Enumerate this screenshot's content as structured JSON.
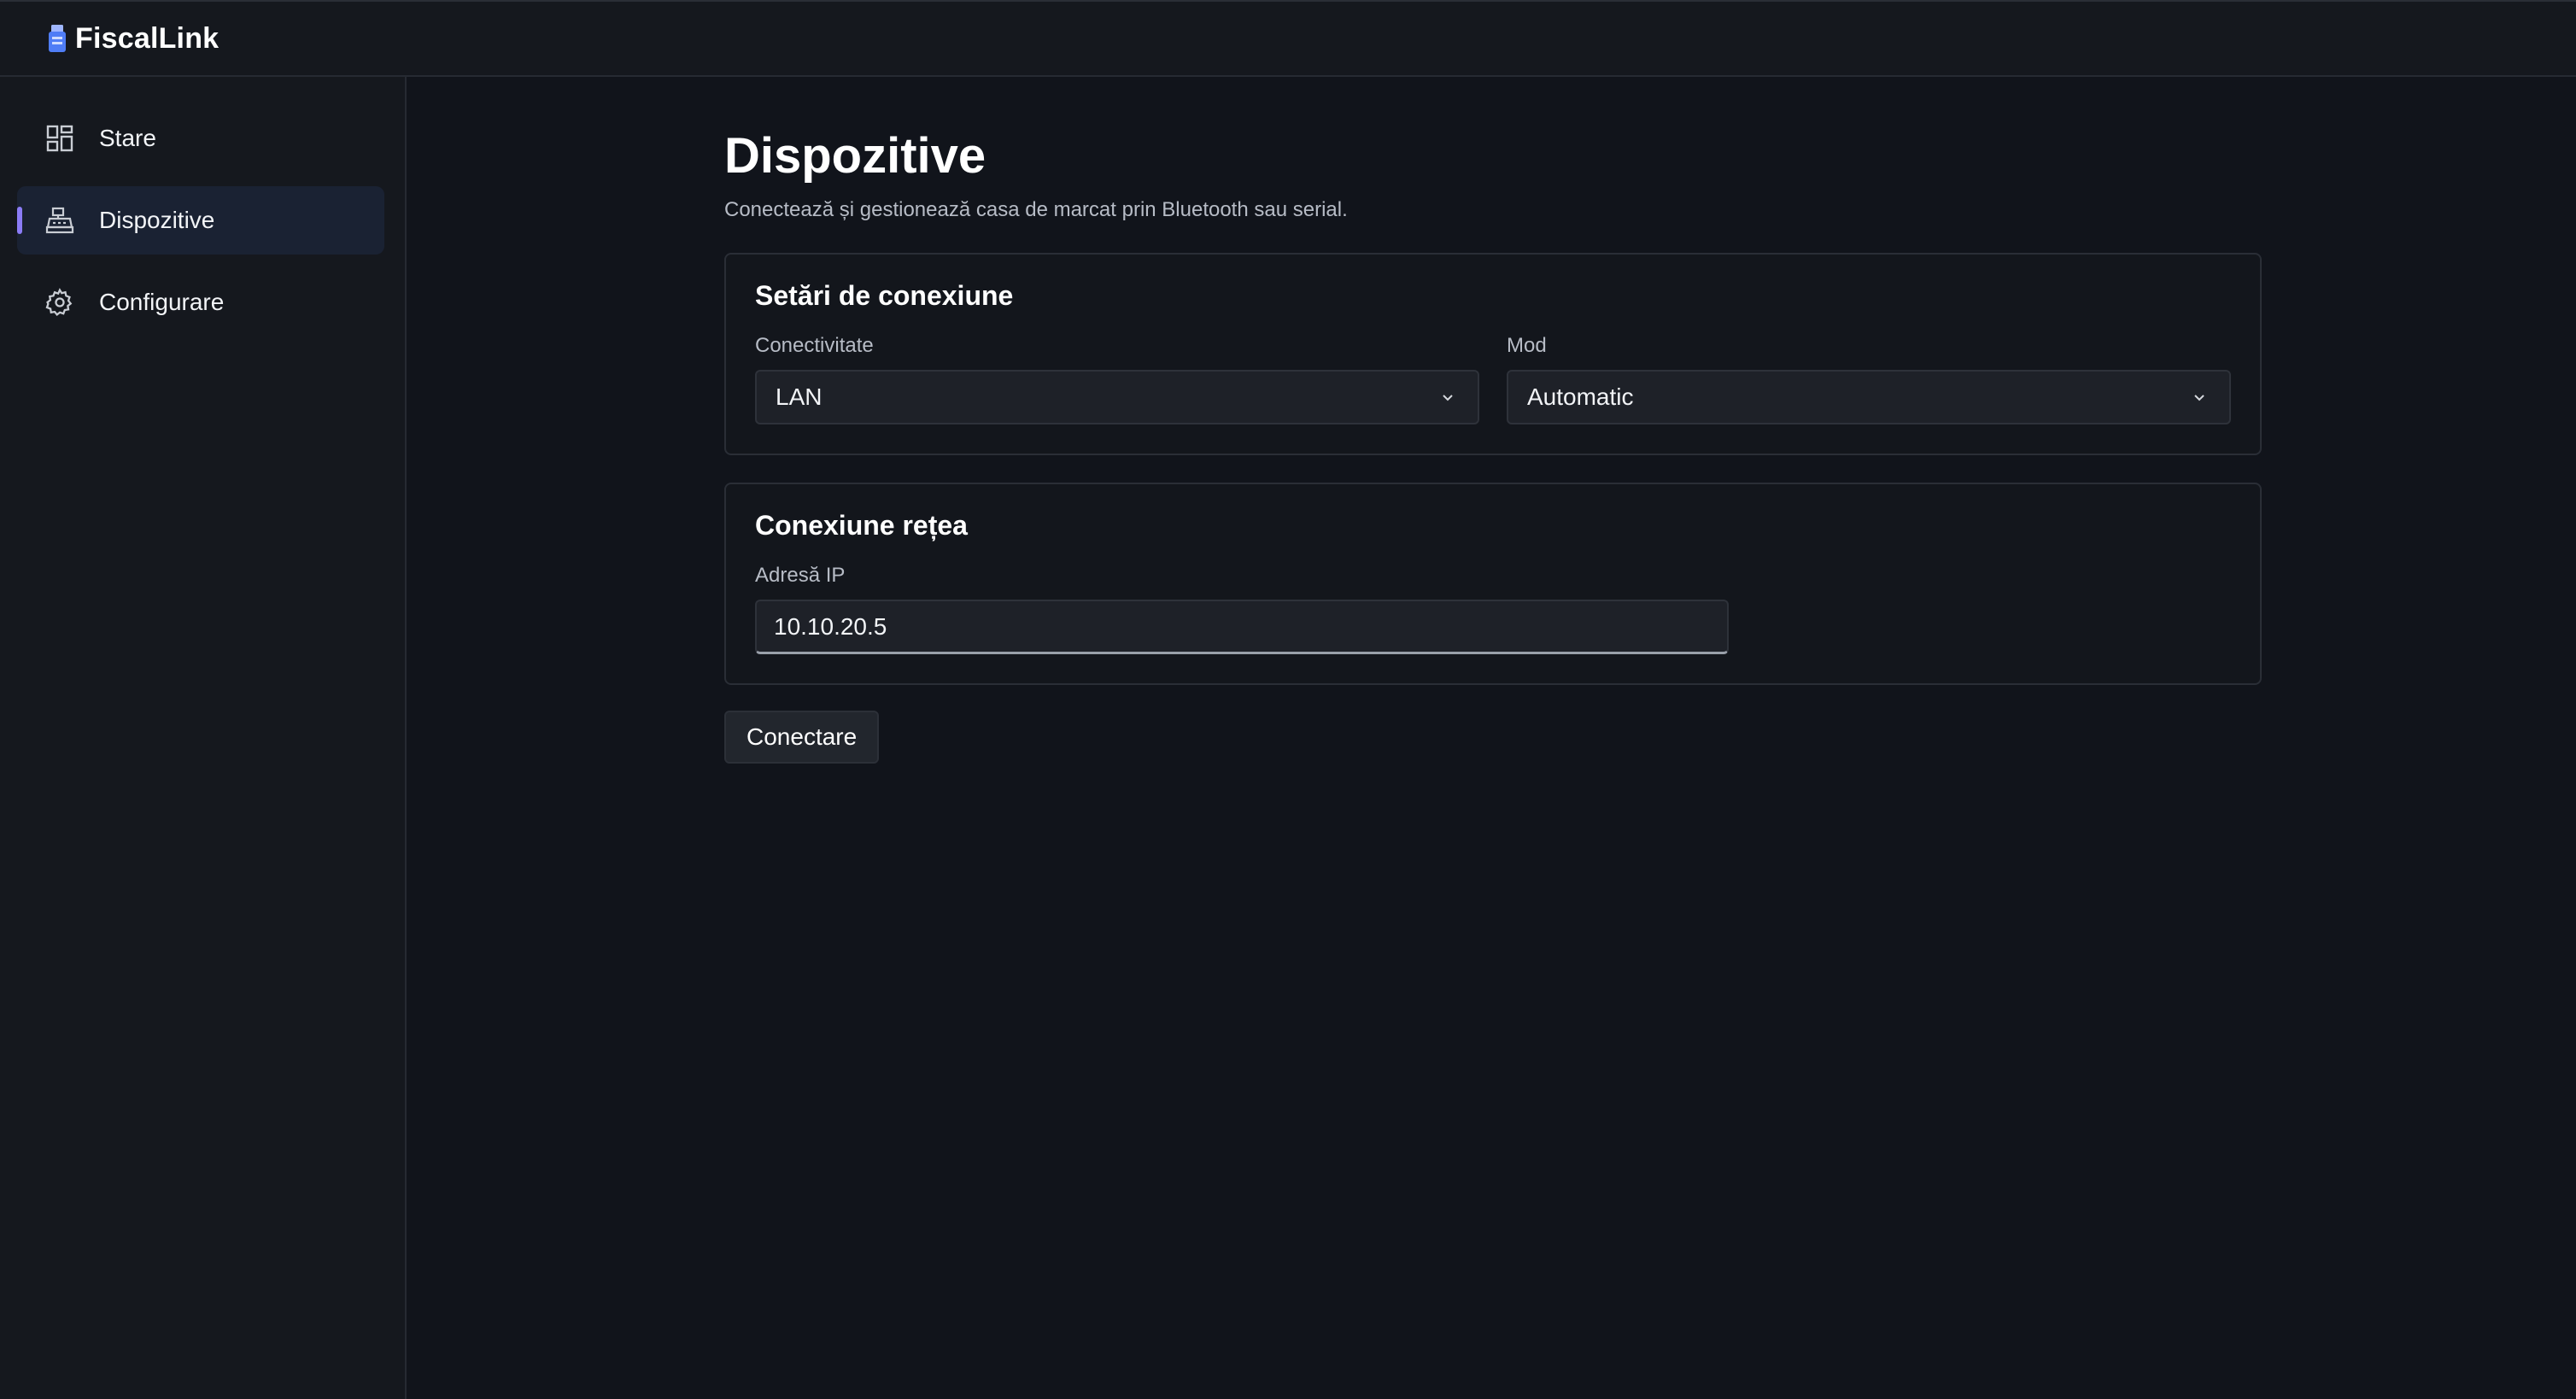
{
  "app": {
    "name": "FiscalLink",
    "logo_icon": "receipt-printer-icon",
    "accent_color": "#8b7cf6",
    "brand_icon_color": "#4f7df6"
  },
  "sidebar": {
    "items": [
      {
        "label": "Stare",
        "icon": "grid-dashboard-icon",
        "active": false
      },
      {
        "label": "Dispozitive",
        "icon": "cash-register-icon",
        "active": true
      },
      {
        "label": "Configurare",
        "icon": "gear-icon",
        "active": false
      }
    ]
  },
  "page": {
    "title": "Dispozitive",
    "subtitle": "Conectează și gestionează casa de marcat prin Bluetooth sau serial."
  },
  "connection_settings": {
    "title": "Setări de conexiune",
    "connectivity": {
      "label": "Conectivitate",
      "value": "LAN"
    },
    "mode": {
      "label": "Mod",
      "value": "Automatic"
    }
  },
  "network": {
    "title": "Conexiune rețea",
    "ip": {
      "label": "Adresă IP",
      "value": "10.10.20.5"
    }
  },
  "actions": {
    "connect_label": "Conectare"
  }
}
